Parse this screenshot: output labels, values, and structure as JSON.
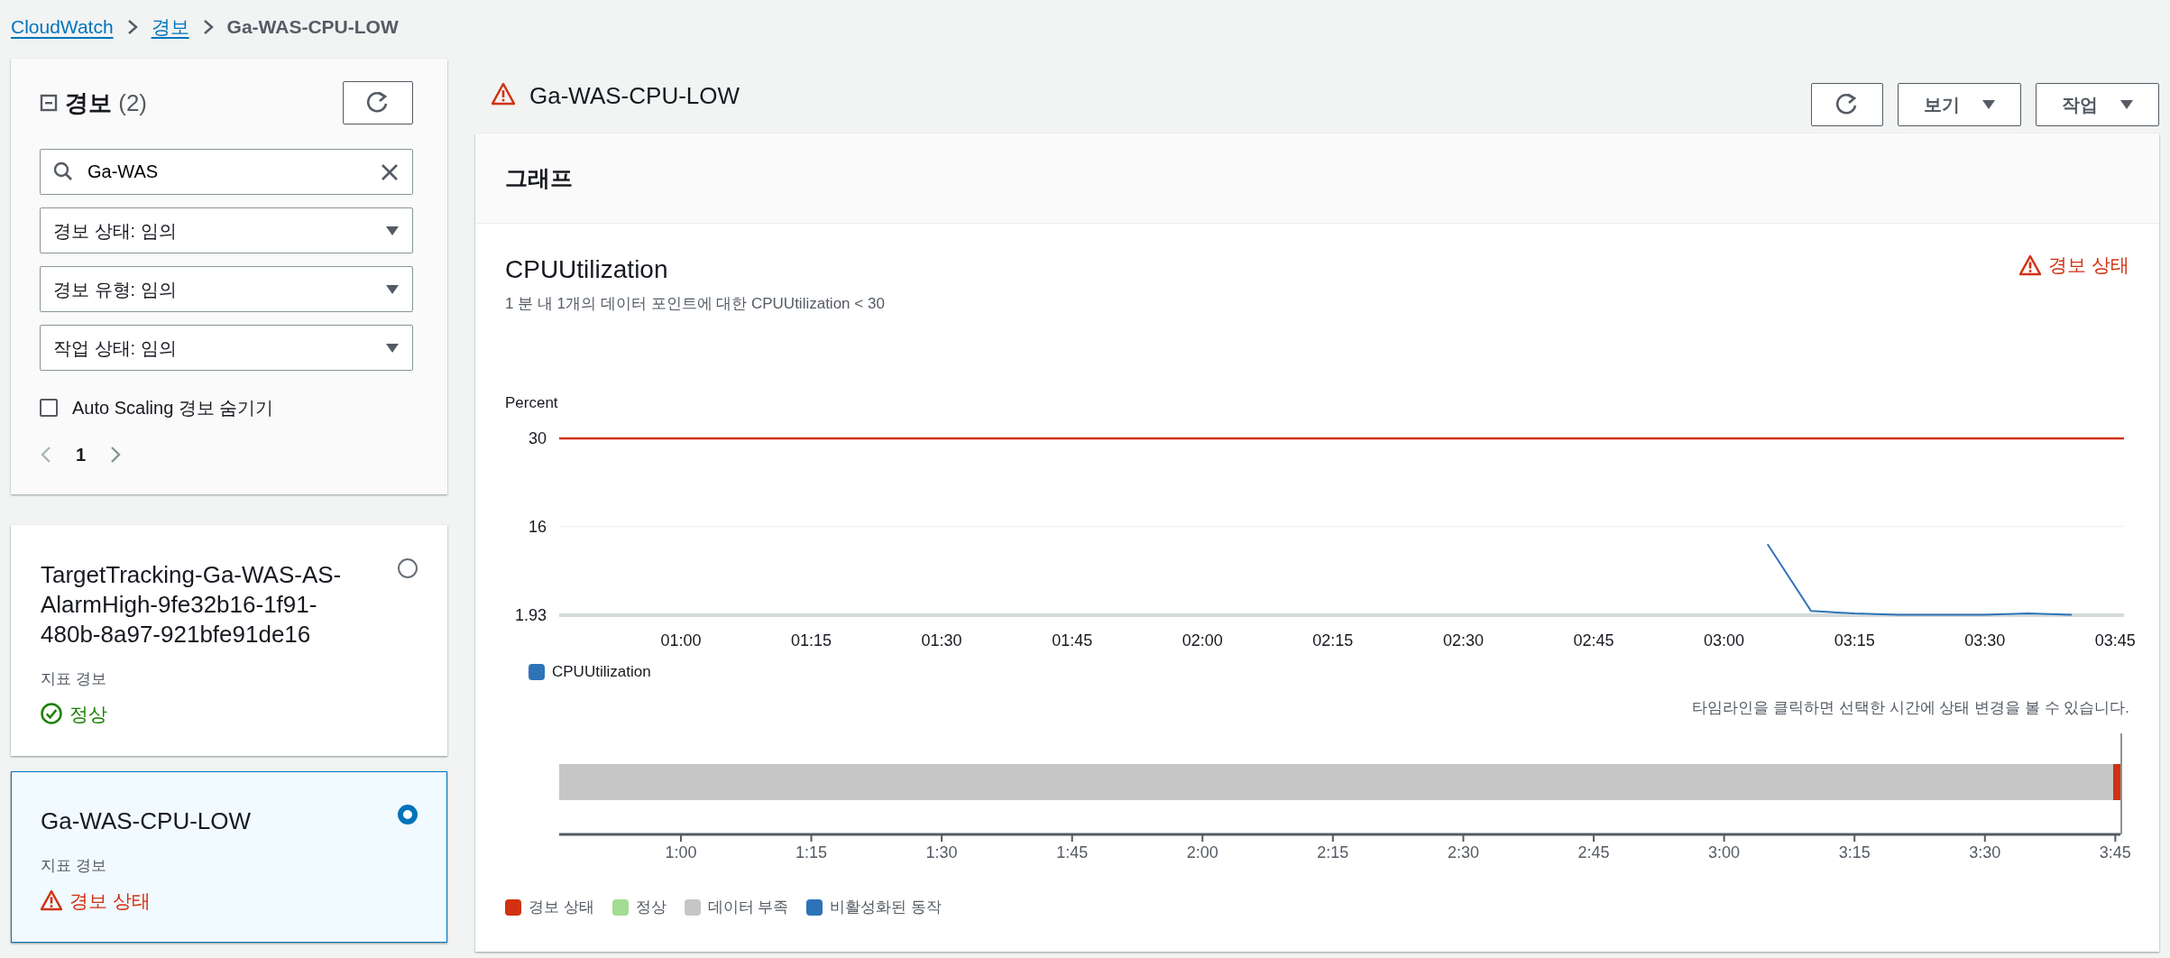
{
  "breadcrumb": [
    {
      "label": "CloudWatch",
      "kind": "link"
    },
    {
      "label": "경보",
      "kind": "link"
    },
    {
      "label": "Ga-WAS-CPU-LOW",
      "kind": "current"
    }
  ],
  "alarm_list": {
    "title": "경보",
    "count": "(2)",
    "search": {
      "value": "Ga-WAS"
    },
    "filters": [
      {
        "value": "경보 상태: 임의"
      },
      {
        "value": "경보 유형: 임의"
      },
      {
        "value": "작업 상태: 임의"
      }
    ],
    "hide_autoscaling": {
      "label": "Auto Scaling 경보 숨기기",
      "checked": false
    },
    "pagination": {
      "page": "1"
    },
    "alarms": [
      {
        "name": "TargetTracking-Ga-WAS-AS-AlarmHigh-9fe32b16-1f91-480b-8a97-921bfe91de16",
        "type": "지표 경보",
        "state": "정상",
        "kind": "ok",
        "selected": false
      },
      {
        "name": "Ga-WAS-CPU-LOW",
        "type": "지표 경보",
        "state": "경보 상태",
        "kind": "alarm",
        "selected": true
      }
    ]
  },
  "detail": {
    "title": "Ga-WAS-CPU-LOW",
    "kind": "alarm",
    "buttons": [
      {
        "label": "보기"
      },
      {
        "label": "작업"
      }
    ],
    "graph_panel": {
      "title": "그래프",
      "metric": "CPUUtilization",
      "description": "1 분 내 1개의 데이터 포인트에 대한 CPUUtilization < 30",
      "state": {
        "label": "경보 상태",
        "kind": "alarm"
      },
      "chart_data": {
        "type": "line",
        "ylabel": "Percent",
        "x": [
          46,
          185,
          190,
          195,
          200,
          205,
          210,
          215,
          220,
          226
        ],
        "series": [
          {
            "name": "CPUUtilization",
            "color": "#2e73b8",
            "values": [
              null,
              13.2,
              2.6,
              2.2,
              2.0,
              2.0,
              2.0,
              2.2,
              2.0,
              null
            ]
          },
          {
            "color": "#d13212",
            "values": [
              30,
              30,
              30,
              30,
              30,
              30,
              30,
              30,
              30,
              30
            ]
          }
        ],
        "xlim": [
          46,
          226
        ],
        "ylim": [
          1.93,
          30
        ],
        "xticks": [
          {
            "value": 60,
            "label": "01:00"
          },
          {
            "value": 75,
            "label": "01:15"
          },
          {
            "value": 90,
            "label": "01:30"
          },
          {
            "value": 105,
            "label": "01:45"
          },
          {
            "value": 120,
            "label": "02:00"
          },
          {
            "value": 135,
            "label": "02:15"
          },
          {
            "value": 150,
            "label": "02:30"
          },
          {
            "value": 165,
            "label": "02:45"
          },
          {
            "value": 180,
            "label": "03:00"
          },
          {
            "value": 195,
            "label": "03:15"
          },
          {
            "value": 210,
            "label": "03:30"
          },
          {
            "value": 225,
            "label": "03:45"
          }
        ],
        "yticks": [
          1.93,
          16,
          30
        ]
      },
      "hint": "타임라인을 클릭하면 선택한 시간에 상태 변경을 볼 수 있습니다.",
      "timeline": {
        "ticks": [
          "1:00",
          "1:15",
          "1:30",
          "1:45",
          "2:00",
          "2:15",
          "2:30",
          "2:45",
          "3:00",
          "3:15",
          "3:30",
          "3:45"
        ],
        "legend": [
          {
            "label": "경보 상태",
            "color": "#d13212"
          },
          {
            "label": "정상",
            "color": "#a3dc93"
          },
          {
            "label": "데이터 부족",
            "color": "#c6c6c6"
          },
          {
            "label": "비활성화된 동작",
            "color": "#2e73b8"
          }
        ]
      }
    }
  }
}
